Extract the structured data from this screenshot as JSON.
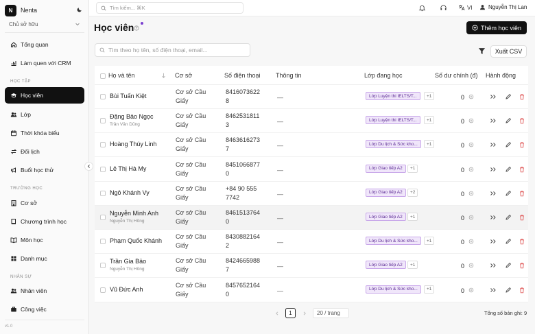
{
  "brand": {
    "logo_letter": "N",
    "name": "Nenta"
  },
  "owner_selector": {
    "value": "Chủ sở hữu"
  },
  "nav": {
    "top": [
      {
        "label": "Tổng quan",
        "icon": "home-icon"
      },
      {
        "label": "Làm quen với CRM",
        "icon": "chart-icon"
      }
    ],
    "group_learning": "HỌC TẬP",
    "learning": [
      {
        "label": "Học viên",
        "icon": "graduation-cap-icon",
        "active": true
      },
      {
        "label": "Lớp",
        "icon": "users-icon"
      },
      {
        "label": "Thời khóa biểu",
        "icon": "calendar-icon"
      },
      {
        "label": "Đổi lịch",
        "icon": "swap-icon"
      },
      {
        "label": "Buổi học thử",
        "icon": "megaphone-icon"
      }
    ],
    "group_school": "TRƯỜNG HỌC",
    "school": [
      {
        "label": "Cơ sở",
        "icon": "building-icon"
      },
      {
        "label": "Chương trình học",
        "icon": "book-icon"
      },
      {
        "label": "Môn học",
        "icon": "open-book-icon"
      },
      {
        "label": "Danh mục",
        "icon": "grid-icon"
      }
    ],
    "group_staff": "NHÂN SỰ",
    "staff": [
      {
        "label": "Nhân viên",
        "icon": "user-group-icon"
      },
      {
        "label": "Công việc",
        "icon": "briefcase-icon"
      }
    ],
    "version": "v1.0"
  },
  "topbar": {
    "search_placeholder": "Tìm kiếm... ⌘K",
    "language": "VI",
    "user_name": "Nguyễn Thị Lan"
  },
  "page": {
    "title": "Học viên",
    "add_button": "Thêm học viên",
    "filter_placeholder": "Tìm theo họ tên, số điện thoại, email...",
    "export_button": "Xuất CSV"
  },
  "table": {
    "headers": {
      "name": "Họ và tên",
      "branch": "Cơ sở",
      "phone": "Số điện thoại",
      "info": "Thông tin",
      "classes": "Lớp đang học",
      "balance": "Số dư chính (đ)",
      "actions": "Hành động"
    },
    "rows": [
      {
        "name": "Bùi Tuấn Kiệt",
        "sub": "",
        "branch": "Cơ sở Cầu Giấy",
        "phone_1": "8416073622",
        "phone_2": "8",
        "info": "—",
        "class": "Lớp Luyện thi IELTS/T...",
        "more": "+1",
        "balance": "0"
      },
      {
        "name": "Đặng Bảo Ngọc",
        "sub": "Trần Văn Dũng",
        "branch": "Cơ sở Cầu Giấy",
        "phone_1": "8462531811",
        "phone_2": "3",
        "info": "—",
        "class": "Lớp Luyện thi IELTS/T...",
        "more": "+1",
        "balance": "0"
      },
      {
        "name": "Hoàng Thúy Linh",
        "sub": "",
        "branch": "Cơ sở Cầu Giấy",
        "phone_1": "8463616273",
        "phone_2": "7",
        "info": "—",
        "class": "Lớp Du lịch & Sức kho...",
        "more": "+1",
        "balance": "0"
      },
      {
        "name": "Lê Thị Hà My",
        "sub": "",
        "branch": "Cơ sở Cầu Giấy",
        "phone_1": "8451066877",
        "phone_2": "0",
        "info": "—",
        "class": "Lớp Giao tiếp A2",
        "more": "+1",
        "balance": "0"
      },
      {
        "name": "Ngô Khánh Vy",
        "sub": "",
        "branch": "Cơ sở Cầu Giấy",
        "phone_1": "+84 90 555",
        "phone_2": "7742",
        "info": "—",
        "class": "Lớp Giao tiếp A2",
        "more": "+2",
        "balance": "0"
      },
      {
        "name": "Nguyễn Minh Anh",
        "sub": "Nguyễn Thị Hồng",
        "branch": "Cơ sở Cầu Giấy",
        "phone_1": "8461513764",
        "phone_2": "0",
        "info": "—",
        "class": "Lớp Giao tiếp A2",
        "more": "+1",
        "balance": "0"
      },
      {
        "name": "Phạm Quốc Khánh",
        "sub": "",
        "branch": "Cơ sở Cầu Giấy",
        "phone_1": "8430882164",
        "phone_2": "2",
        "info": "—",
        "class": "Lớp Du lịch & Sức kho...",
        "more": "+1",
        "balance": "0"
      },
      {
        "name": "Trần Gia Bảo",
        "sub": "Nguyễn Thị Hồng",
        "branch": "Cơ sở Cầu Giấy",
        "phone_1": "8424665988",
        "phone_2": "7",
        "info": "—",
        "class": "Lớp Giao tiếp A2",
        "more": "+1",
        "balance": "0"
      },
      {
        "name": "Vũ Đức Anh",
        "sub": "",
        "branch": "Cơ sở Cầu Giấy",
        "phone_1": "8457652164",
        "phone_2": "0",
        "info": "—",
        "class": "Lớp Du lịch & Sức kho...",
        "more": "+1",
        "balance": "0"
      }
    ]
  },
  "pagination": {
    "current_page": "1",
    "page_size": "20 / trang",
    "total": "Tổng số bản ghi: 9"
  },
  "colors": {
    "accent": "#111111",
    "tag_bg": "#f0e6fa",
    "tag_text": "#5b2a94",
    "delete": "#e05a5a"
  }
}
